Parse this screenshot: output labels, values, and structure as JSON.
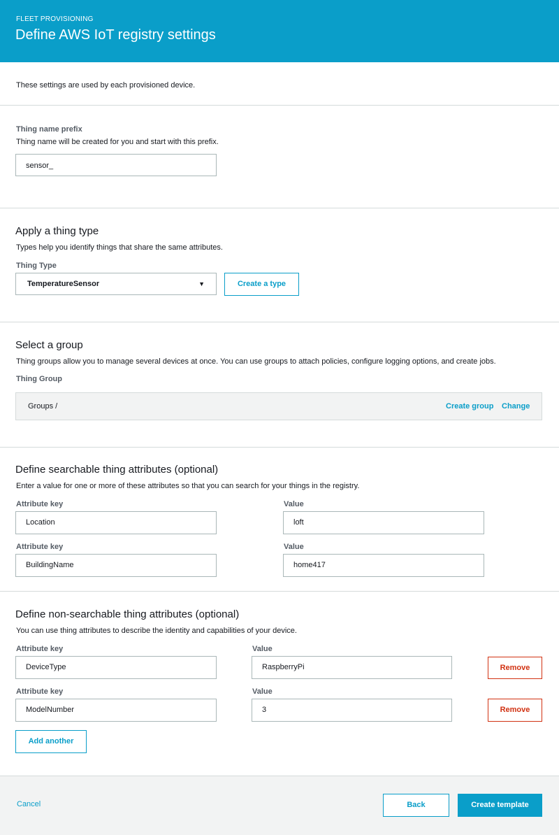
{
  "header": {
    "eyebrow": "FLEET PROVISIONING",
    "title": "Define AWS IoT registry settings"
  },
  "intro": "These settings are used by each provisioned device.",
  "thing_name": {
    "label": "Thing name prefix",
    "description": "Thing name will be created for you and start with this prefix.",
    "value": "sensor_"
  },
  "thing_type": {
    "heading": "Apply a thing type",
    "description": "Types help you identify things that share the same attributes.",
    "label": "Thing Type",
    "selected": "TemperatureSensor",
    "create_button": "Create a type"
  },
  "group": {
    "heading": "Select a group",
    "description": "Thing groups allow you to manage several devices at once. You can use groups to attach policies, configure logging options, and create jobs.",
    "label": "Thing Group",
    "path": "Groups /",
    "create_link": "Create group",
    "change_link": "Change"
  },
  "searchable": {
    "heading": "Define searchable thing attributes (optional)",
    "description": "Enter a value for one or more of these attributes so that you can search for your things in the registry.",
    "key_label": "Attribute key",
    "value_label": "Value",
    "rows": [
      {
        "key": "Location",
        "value": "loft"
      },
      {
        "key": "BuildingName",
        "value": "home417"
      }
    ]
  },
  "nonsearchable": {
    "heading": "Define non-searchable thing attributes (optional)",
    "description": "You can use thing attributes to describe the identity and capabilities of your device.",
    "key_label": "Attribute key",
    "value_label": "Value",
    "remove_label": "Remove",
    "add_label": "Add another",
    "rows": [
      {
        "key": "DeviceType",
        "value": "RaspberryPi"
      },
      {
        "key": "ModelNumber",
        "value": "3"
      }
    ]
  },
  "footer": {
    "cancel": "Cancel",
    "back": "Back",
    "create": "Create template"
  },
  "colors": {
    "accent": "#0a9ec9",
    "danger": "#d13212",
    "border": "#aab7b8"
  }
}
